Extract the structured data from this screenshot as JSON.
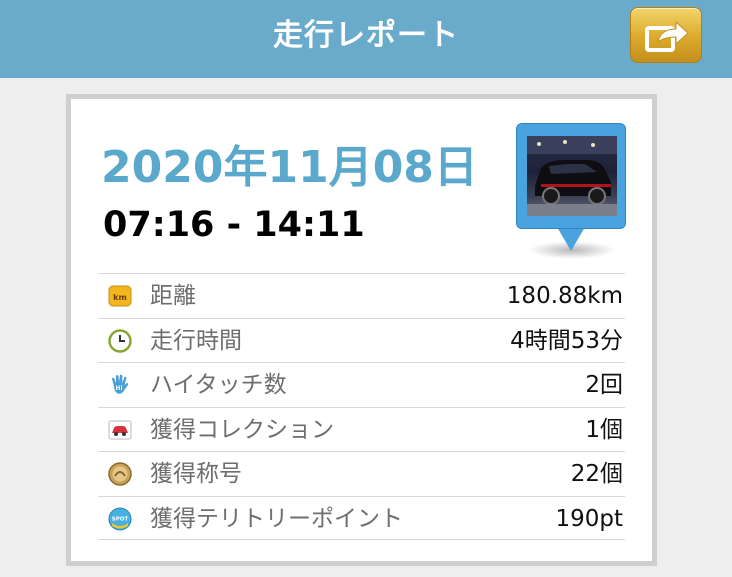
{
  "header": {
    "title": "走行レポート",
    "share_icon": "share-arrow-icon",
    "accent_color": "#6aaacb",
    "share_button_color": "#dba92c"
  },
  "report": {
    "date": "2020年11月08日",
    "time_range": "07:16 - 14:11",
    "date_color": "#5aa8cc",
    "thumbnail": "car-photo-pin"
  },
  "stats": [
    {
      "icon": "km-badge-icon",
      "label": "距離",
      "value": "180.88km"
    },
    {
      "icon": "clock-icon",
      "label": "走行時間",
      "value": "4時間53分"
    },
    {
      "icon": "hi-touch-hand-icon",
      "label": "ハイタッチ数",
      "value": "2回"
    },
    {
      "icon": "car-collection-icon",
      "label": "獲得コレクション",
      "value": "1個"
    },
    {
      "icon": "title-medal-icon",
      "label": "獲得称号",
      "value": "22個"
    },
    {
      "icon": "spot-icon",
      "label": "獲得テリトリーポイント",
      "value": "190pt"
    }
  ]
}
